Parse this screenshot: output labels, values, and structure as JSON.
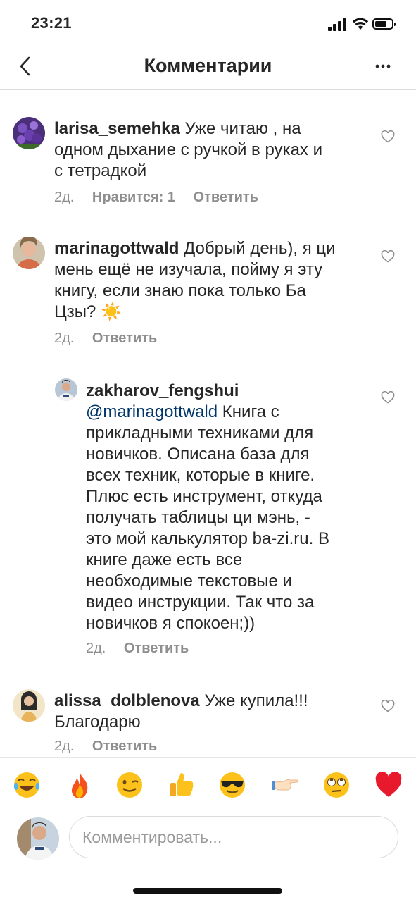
{
  "status_bar": {
    "time": "23:21"
  },
  "header": {
    "title": "Комментарии",
    "back_icon": "chevron-left-icon",
    "more_icon": "ellipsis-icon"
  },
  "comments": [
    {
      "username": "larisa_semehka",
      "lines": [
        "Уже читаю , на",
        "одном дыхание с ручкой в руках и",
        "с тетрадкой"
      ],
      "time": "2д.",
      "likes": "Нравится: 1",
      "reply": "Ответить"
    },
    {
      "username": "marinagottwald",
      "lines": [
        "Добрый день), я ци",
        "мень ещё не изучала, пойму я эту",
        "книгу, если знаю пока только Ба",
        "Цзы? ☀️"
      ],
      "time": "2д.",
      "reply": "Ответить"
    },
    {
      "username": "zakharov_fengshui",
      "mention": "@marinagottwald",
      "lines": [
        "Книга с",
        "прикладными техниками для",
        "новичков. Описана база для",
        "всех техник, которые в книге.",
        "Плюс есть инструмент, откуда",
        "получать таблицы ци мэнь, -",
        "это мой калькулятор ba-zi.ru. В",
        "книге даже есть все",
        "необходимые текстовые и",
        "видео инструкции. Так что за",
        "новичков я спокоен;))"
      ],
      "time": "2д.",
      "reply": "Ответить"
    },
    {
      "username": "alissa_dolblenova",
      "lines": [
        "Уже купила!!!",
        "Благодарю"
      ],
      "time": "2д.",
      "reply": "Ответить"
    }
  ],
  "emoji_bar": [
    "😂",
    "🔥",
    "😉",
    "👍",
    "😎",
    "👉",
    "🙄",
    "❤️"
  ],
  "composer": {
    "placeholder": "Комментировать..."
  }
}
